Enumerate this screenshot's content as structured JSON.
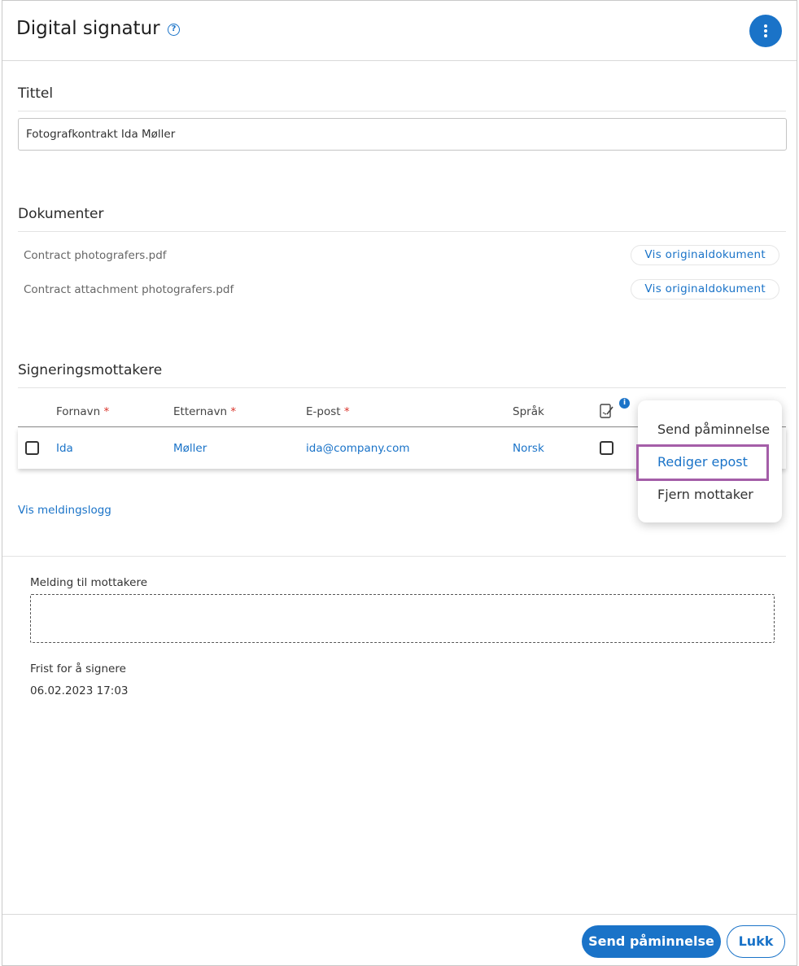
{
  "header": {
    "title": "Digital signatur",
    "help_icon": "?"
  },
  "title_section": {
    "heading": "Tittel",
    "value": "Fotografkontrakt Ida Møller"
  },
  "documents": {
    "heading": "Dokumenter",
    "items": [
      {
        "name": "Contract photografers.pdf",
        "button": "Vis originaldokument"
      },
      {
        "name": "Contract attachment photografers.pdf",
        "button": "Vis originaldokument"
      }
    ]
  },
  "recipients": {
    "heading": "Signeringsmottakere",
    "columns": {
      "first_name": "Fornavn",
      "last_name": "Etternavn",
      "email": "E-post",
      "language": "Språk",
      "required_marker": "*"
    },
    "rows": [
      {
        "first_name": "Ida",
        "last_name": "Møller",
        "email": "ida@company.com",
        "language": "Norsk"
      }
    ],
    "info_icon": "i",
    "log_link": "Vis meldingslogg"
  },
  "context_menu": {
    "items": [
      "Send påminnelse",
      "Rediger epost",
      "Fjern mottaker"
    ],
    "highlighted_index": 1
  },
  "message": {
    "label": "Melding til mottakere",
    "value": ""
  },
  "deadline": {
    "label": "Frist for å signere",
    "value": "06.02.2023 17:03"
  },
  "footer": {
    "primary_button": "Send påminnelse",
    "secondary_button": "Lukk"
  },
  "colors": {
    "accent": "#1a73c8",
    "required": "#d9342b",
    "highlight_border": "#a45ea8"
  }
}
